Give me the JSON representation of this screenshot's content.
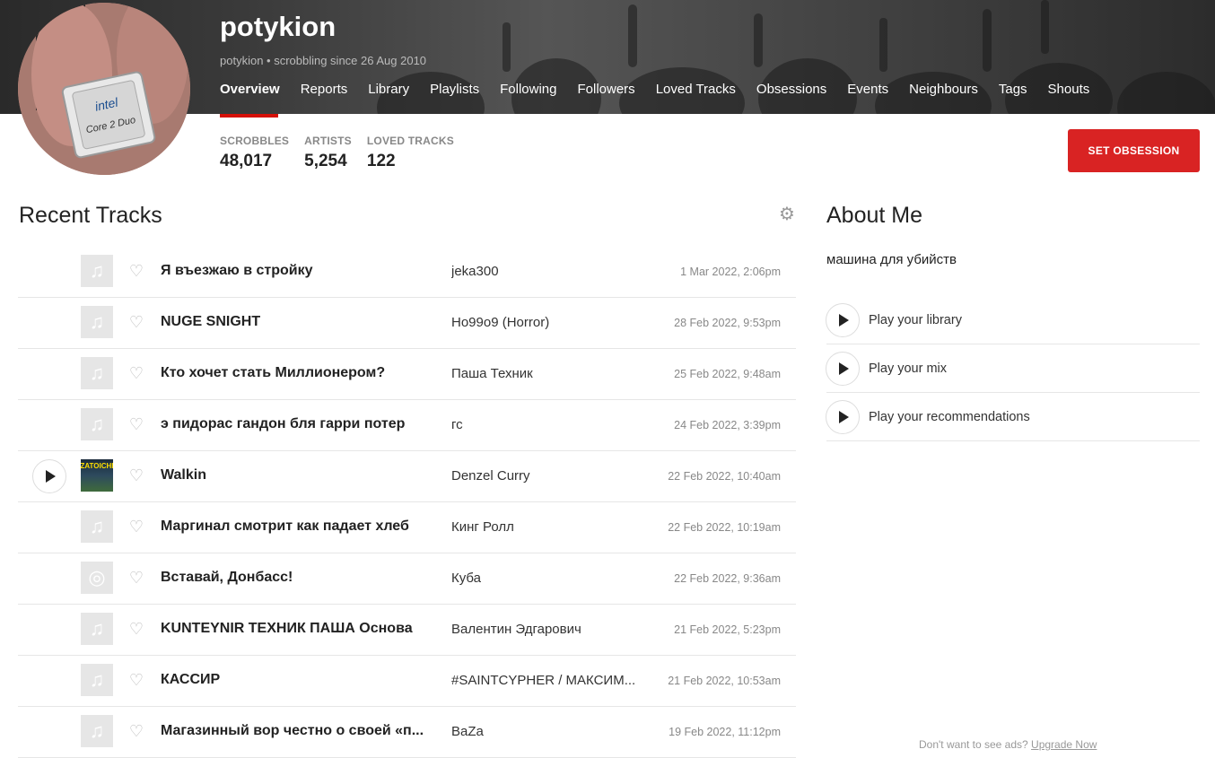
{
  "profile": {
    "username": "potykion",
    "subtitle": "potykion • scrobbling since 26 Aug 2010",
    "avatar_text_top": "intel",
    "avatar_text_bottom": "Core 2 Duo"
  },
  "nav": [
    {
      "label": "Overview",
      "active": true
    },
    {
      "label": "Reports"
    },
    {
      "label": "Library"
    },
    {
      "label": "Playlists"
    },
    {
      "label": "Following"
    },
    {
      "label": "Followers"
    },
    {
      "label": "Loved Tracks"
    },
    {
      "label": "Obsessions"
    },
    {
      "label": "Events"
    },
    {
      "label": "Neighbours"
    },
    {
      "label": "Tags"
    },
    {
      "label": "Shouts"
    }
  ],
  "stats": [
    {
      "label": "SCROBBLES",
      "value": "48,017"
    },
    {
      "label": "ARTISTS",
      "value": "5,254"
    },
    {
      "label": "LOVED TRACKS",
      "value": "122"
    }
  ],
  "set_obsession_label": "SET OBSESSION",
  "recent_tracks": {
    "title": "Recent Tracks",
    "items": [
      {
        "title": "Я въезжаю в стройку",
        "artist": "jeka300",
        "time": "1 Mar 2022, 2:06pm",
        "cover": "note"
      },
      {
        "title": "NUGE SNIGHT",
        "artist": "Ho99o9 (Horror)",
        "time": "28 Feb 2022, 9:53pm",
        "cover": "note"
      },
      {
        "title": "Кто хочет стать Миллионером?",
        "artist": "Паша Техник",
        "time": "25 Feb 2022, 9:48am",
        "cover": "note"
      },
      {
        "title": "э пидорас гандон бля гарри потер",
        "artist": "гс",
        "time": "24 Feb 2022, 3:39pm",
        "cover": "note"
      },
      {
        "title": "Walkin",
        "artist": "Denzel Curry",
        "time": "22 Feb 2022, 10:40am",
        "cover": "art",
        "cover_text": "ZATOICHI",
        "has_play": true
      },
      {
        "title": "Маргинал смотрит как падает хлеб",
        "artist": "Кинг Ролл",
        "time": "22 Feb 2022, 10:19am",
        "cover": "note"
      },
      {
        "title": "Вставай, Донбасс!",
        "artist": "Куба",
        "time": "22 Feb 2022, 9:36am",
        "cover": "disc"
      },
      {
        "title": "KUNTEYNIR ТЕХНИК ПАША Основа",
        "artist": "Валентин Эдгарович",
        "time": "21 Feb 2022, 5:23pm",
        "cover": "note"
      },
      {
        "title": "КАССИР",
        "artist": "#SAINTCYPHER / МАКСИМ...",
        "time": "21 Feb 2022, 10:53am",
        "cover": "note"
      },
      {
        "title": "Магазинный вор честно о своей «п...",
        "artist": "BaZa",
        "time": "19 Feb 2022, 11:12pm",
        "cover": "note"
      }
    ]
  },
  "about": {
    "title": "About Me",
    "text": "машина для убийств",
    "play_items": [
      {
        "label": "Play your library"
      },
      {
        "label": "Play your mix"
      },
      {
        "label": "Play your recommendations"
      }
    ]
  },
  "ads": {
    "text": "Don't want to see ads?",
    "link": "Upgrade Now"
  },
  "icons": {
    "cover_note": "music-note-icon",
    "cover_disc": "disc-icon",
    "heart": "heart-icon",
    "gear": "gear-icon",
    "play": "play-icon"
  },
  "colors": {
    "accent": "#d51007",
    "button": "#d92323"
  }
}
